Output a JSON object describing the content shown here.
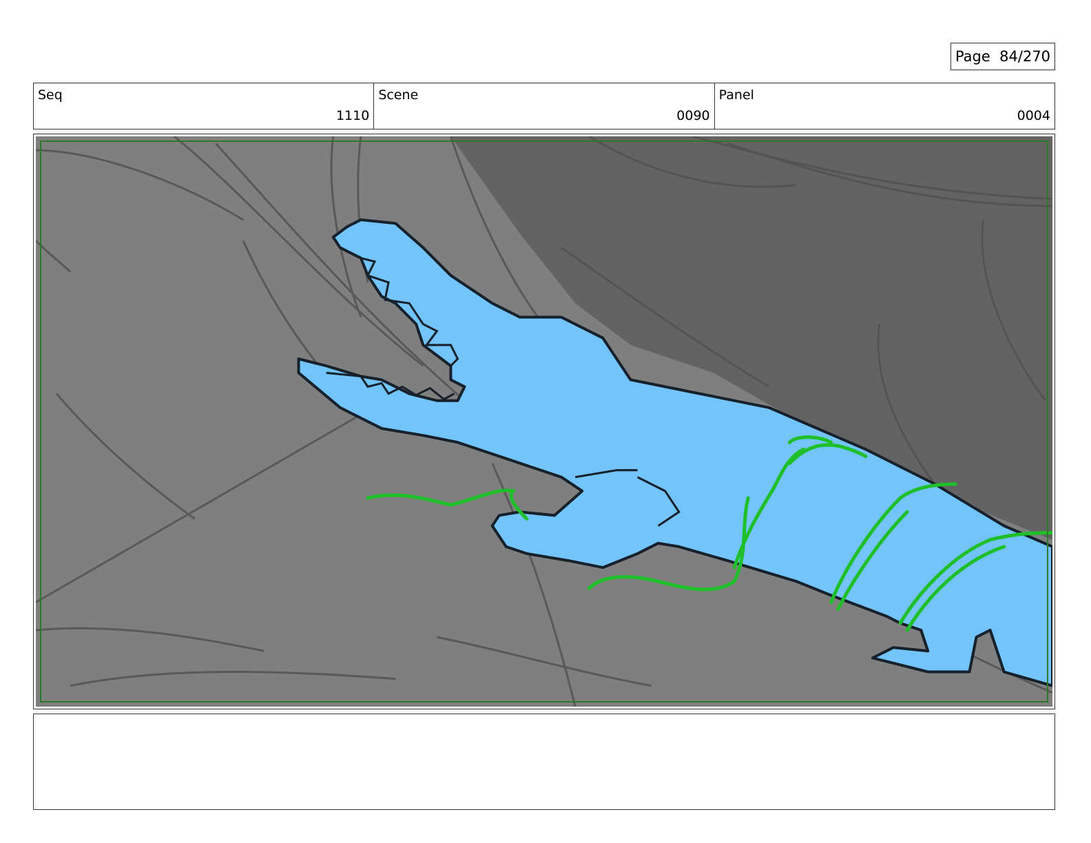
{
  "page": {
    "label": "Page",
    "number": "84/270"
  },
  "header": {
    "seq": {
      "label": "Seq",
      "value": "1110"
    },
    "scene": {
      "label": "Scene",
      "value": "0090"
    },
    "panel": {
      "label": "Panel",
      "value": "0004"
    }
  },
  "panel_image": {
    "subject": "crocodile-sketch",
    "colors": {
      "background": "#7f7f7f",
      "shadow": "#636363",
      "fill": "#72c4fb",
      "outline": "#17212b",
      "motion": "#1fbf2a",
      "sketch": "#505050",
      "safe_frame": "#2a7a2a"
    }
  },
  "notes": {
    "text": ""
  }
}
